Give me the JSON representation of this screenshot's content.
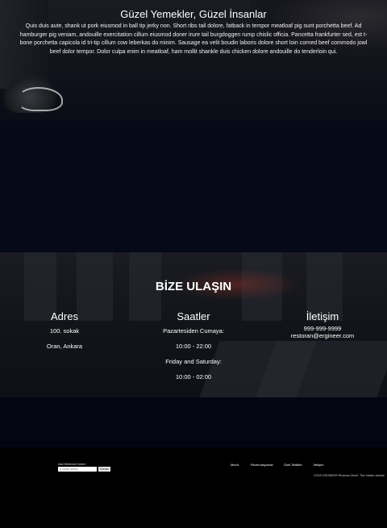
{
  "hero": {
    "title": "Güzel Yemekler, Güzel İnsanlar",
    "text": "Quis duis aute, shank ut pork eiusmod in ball tip jerky non. Short ribs tail dolore, fatback in tempor meatloaf pig sunt porchetta beef. Ad hamburger pig veniam, andouille exercitation cillum eiusmod doner irure tail burgdoggen rump chislic officia. Pancetta frankfurter sed, est t-bone porchetta capicola id tri-tip cillum cow leberkas do minim. Sausage ea velit boudin laboris dolore short loin corned beef commodo jowl beef dolor tempor. Dolor culpa enim in meatloaf, ham mollit shankle duis chicken dolore andouille do tenderloin qui."
  },
  "contact": {
    "title": "BİZE ULAŞIN",
    "address": {
      "heading": "Adres",
      "line1": "100. sokak",
      "line2": "Oran, Ankara"
    },
    "hours": {
      "heading": "Saatler",
      "weekday_label": "Pazartesiden Cumaya:",
      "weekday_hours": "10:00 - 22:00",
      "weekend_label": "Friday and Saturday:",
      "weekend_hours": "10:00 - 02:00"
    },
    "communication": {
      "heading": "İletişim",
      "phone": "999-999-9999",
      "email": "restoran@ergineer.com"
    }
  },
  "footer": {
    "newsletter_label": "Abel Bültenine Katılın!",
    "newsletter_placeholder": "E-posta adresi",
    "newsletter_button": "Gönder",
    "nav": [
      "Menü",
      "Rezervasyonlar",
      "Özel Teklifler",
      "İletişim"
    ],
    "copyright": "©2020 ERGİNEER Restoran Zinciri. Tüm hakları saklıdır."
  }
}
